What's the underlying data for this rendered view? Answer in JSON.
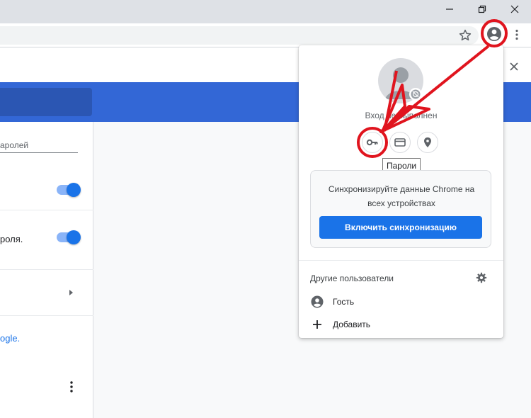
{
  "popup": {
    "status_text": "Вход не выполнен",
    "tooltip": "Пароли",
    "sync_message_line1": "Синхронизируйте данные Chrome на",
    "sync_message_line2": "всех устройствах",
    "sync_button": "Включить синхронизацию",
    "other_users_label": "Другие пользователи",
    "users": [
      {
        "label": "Гость",
        "icon": "guest-icon"
      },
      {
        "label": "Добавить",
        "icon": "add-icon"
      }
    ],
    "quick_buttons": [
      "key-icon",
      "credit-card-icon",
      "location-pin-icon"
    ]
  },
  "settings": {
    "search_placeholder": "аролей",
    "row2_text": "роля.",
    "link_text": "ogle."
  },
  "colors": {
    "accent": "#1a73e8",
    "header_blue": "#3367d6",
    "annotation_red": "#e0141e"
  }
}
